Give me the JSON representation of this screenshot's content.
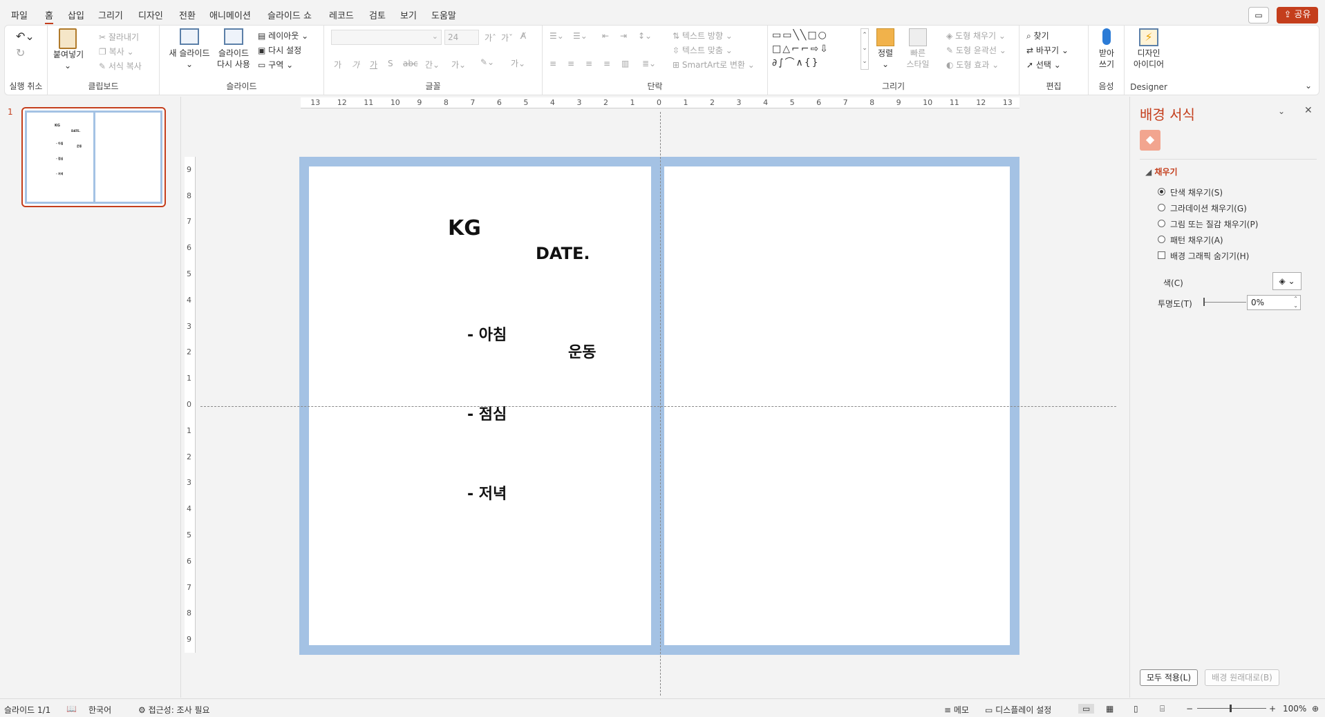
{
  "menu": {
    "items": [
      "파일",
      "홈",
      "삽입",
      "그리기",
      "디자인",
      "전환",
      "애니메이션",
      "슬라이드 쇼",
      "레코드",
      "검토",
      "보기",
      "도움말"
    ],
    "active": "홈",
    "share_label": "공유"
  },
  "ribbon": {
    "undo_group_label": "실행 취소",
    "clipboard": {
      "label": "클립보드",
      "paste": "붙여넣기",
      "cut": "잘라내기",
      "copy": "복사",
      "format_painter": "서식 복사"
    },
    "slides": {
      "label": "슬라이드",
      "new_slide": "새 슬라이드",
      "reuse_line1": "슬라이드",
      "reuse_line2": "다시 사용",
      "layout": "레이아웃",
      "reset": "다시 설정",
      "section": "구역"
    },
    "font": {
      "label": "글꼴",
      "size": "24"
    },
    "paragraph": {
      "label": "단락",
      "text_direction": "텍스트 방향",
      "align_text": "텍스트 맞춤",
      "smartart": "SmartArt로 변환"
    },
    "drawing": {
      "label": "그리기",
      "arrange": "정렬",
      "quick_line1": "빠른",
      "quick_line2": "스타일",
      "shape_fill": "도형 채우기",
      "shape_outline": "도형 윤곽선",
      "shape_effects": "도형 효과"
    },
    "editing": {
      "label": "편집",
      "find": "찾기",
      "replace": "바꾸기",
      "select": "선택"
    },
    "voice": {
      "label": "음성",
      "dictate_line1": "받아",
      "dictate_line2": "쓰기"
    },
    "designer": {
      "label": "Designer",
      "ideas_line1": "디자인",
      "ideas_line2": "아이디어"
    }
  },
  "thumbnails": {
    "slide_number": "1"
  },
  "slide": {
    "title": "KG",
    "date": "DATE.",
    "bullet1": "-  아침",
    "bullet2": "-  점심",
    "bullet3": "-  저녁",
    "exercise": "운동"
  },
  "rulers": {
    "h_ticks": [
      "13",
      "12",
      "11",
      "10",
      "9",
      "8",
      "7",
      "6",
      "5",
      "4",
      "3",
      "2",
      "1",
      "0",
      "1",
      "2",
      "3",
      "4",
      "5",
      "6",
      "7",
      "8",
      "9",
      "10",
      "11",
      "12",
      "13"
    ],
    "v_ticks": [
      "9",
      "8",
      "7",
      "6",
      "5",
      "4",
      "3",
      "2",
      "1",
      "0",
      "1",
      "2",
      "3",
      "4",
      "5",
      "6",
      "7",
      "8",
      "9"
    ]
  },
  "format_pane": {
    "title": "배경 서식",
    "section": "채우기",
    "options": [
      "단색 채우기(S)",
      "그라데이션 채우기(G)",
      "그림 또는 질감 채우기(P)",
      "패턴 채우기(A)"
    ],
    "hide_graphics": "배경 그래픽 숨기기(H)",
    "color_label": "색(C)",
    "transparency_label": "투명도(T)",
    "transparency_value": "0%",
    "apply_all": "모두 적용(L)",
    "reset": "배경 원래대로(B)"
  },
  "status": {
    "slide_count": "슬라이드 1/1",
    "language": "한국어",
    "accessibility": "접근성: 조사 필요",
    "notes": "메모",
    "display": "디스플레이 설정",
    "zoom": "100%"
  },
  "colors": {
    "accent": "#c43e1c",
    "slide_border": "#a4c2e4"
  }
}
